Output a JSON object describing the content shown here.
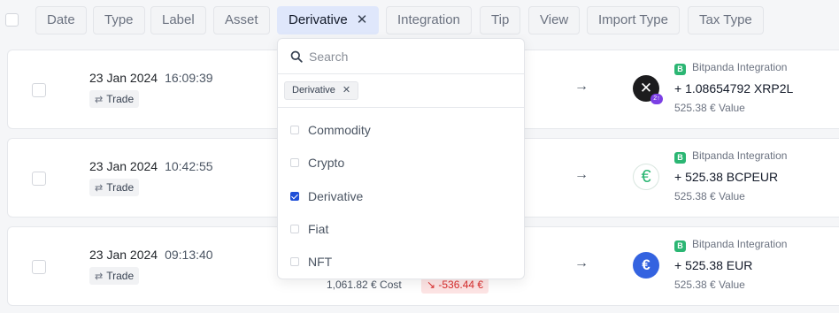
{
  "filters": {
    "chips": [
      {
        "label": "Date"
      },
      {
        "label": "Type"
      },
      {
        "label": "Label"
      },
      {
        "label": "Asset"
      },
      {
        "label": "Derivative",
        "active": true
      },
      {
        "label": "Integration"
      },
      {
        "label": "Tip"
      },
      {
        "label": "View"
      },
      {
        "label": "Import Type"
      },
      {
        "label": "Tax Type"
      }
    ]
  },
  "dropdown": {
    "search_placeholder": "Search",
    "selected_chip": "Derivative",
    "options": [
      {
        "label": "Commodity",
        "checked": false
      },
      {
        "label": "Crypto",
        "checked": false
      },
      {
        "label": "Derivative",
        "checked": true
      },
      {
        "label": "Fiat",
        "checked": false
      },
      {
        "label": "NFT",
        "checked": false
      }
    ]
  },
  "transactions": [
    {
      "date": "23 Jan 2024",
      "time": "16:09:39",
      "type": "Trade",
      "integration": "Bitpanda Integration",
      "amount": "+ 1.08654792 XRP2L",
      "value": "525.38 € Value",
      "coin_icon": "xrp-icon",
      "coin_badge": "2↑"
    },
    {
      "date": "23 Jan 2024",
      "time": "10:42:55",
      "type": "Trade",
      "integration": "Bitpanda Integration",
      "amount": "+ 525.38 BCPEUR",
      "value": "525.38 € Value",
      "coin_icon": "euro-outline-icon",
      "coin_glyph": "€"
    },
    {
      "date": "23 Jan 2024",
      "time": "09:13:40",
      "type": "Trade",
      "integration": "Bitpanda Integration",
      "amount": "+ 525.38 EUR",
      "value": "525.38 € Value",
      "coin_icon": "euro-icon",
      "coin_glyph": "€",
      "cost": "1,061.82 € Cost",
      "loss": "↘ -536.44 €"
    }
  ],
  "colors": {
    "accent": "#1f4fd8",
    "active_chip": "#dfe7fb",
    "bitpanda_green": "#2bb673",
    "loss_red": "#d92d2d"
  }
}
